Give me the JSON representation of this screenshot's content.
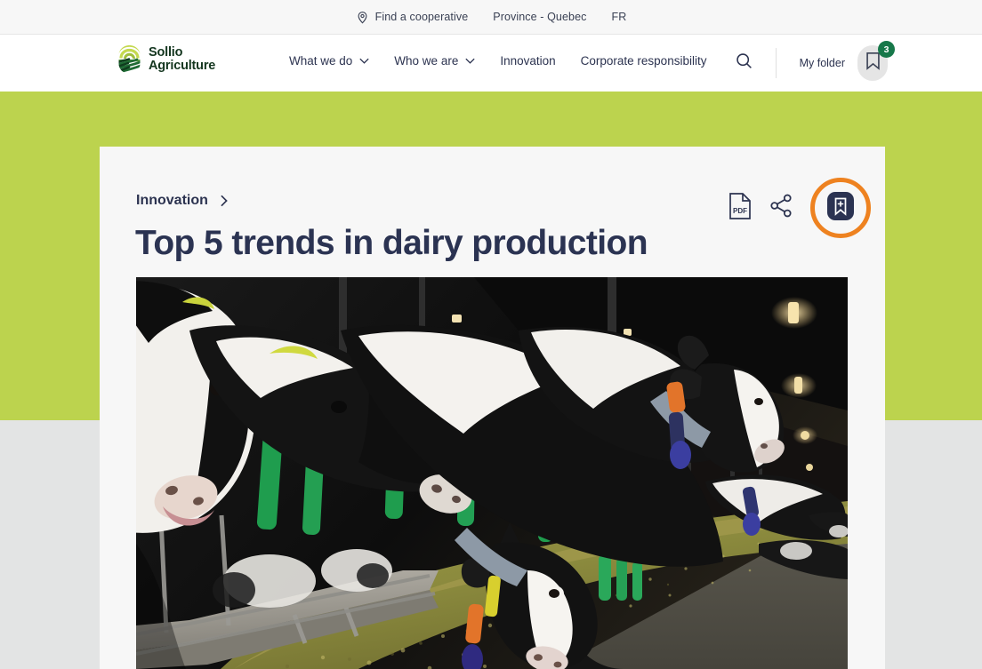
{
  "utility_bar": {
    "items": [
      {
        "label": "Find a cooperative",
        "icon": "location-pin-icon"
      },
      {
        "label": "Province - Quebec",
        "icon": null
      },
      {
        "label": "FR",
        "icon": null
      }
    ]
  },
  "header": {
    "logo": {
      "line1": "Sollio",
      "line2": "Agriculture",
      "icon": "sollio-field-logo"
    },
    "nav": [
      {
        "label": "What we do",
        "has_dropdown": true
      },
      {
        "label": "Who we are",
        "has_dropdown": true
      },
      {
        "label": "Innovation",
        "has_dropdown": false
      },
      {
        "label": "Corporate responsibility",
        "has_dropdown": false
      }
    ],
    "search_icon": "search-icon",
    "my_folder_label": "My folder",
    "folder_icon": "bookmark-icon",
    "folder_badge_count": "3"
  },
  "content": {
    "breadcrumb": {
      "label": "Innovation",
      "chevron": "chevron-right-icon"
    },
    "title": "Top 5 trends in dairy production",
    "actions": [
      {
        "name": "download-pdf",
        "icon": "pdf-file-icon",
        "label": "PDF"
      },
      {
        "name": "share",
        "icon": "share-icon",
        "label": ""
      },
      {
        "name": "save-to-folder",
        "icon": "bookmark-plus-icon",
        "label": "",
        "focused": true
      }
    ],
    "hero_image_alt": "Holstein dairy cows feeding at a barn feed alley with green headlock rails and monitoring collars"
  },
  "colors": {
    "brand_green_band": "#bcd34e",
    "logo_dark_green": "#14361f",
    "navy_text": "#2b3352",
    "accent_orange": "#ee8220",
    "badge_green": "#17784a",
    "card_bg": "#f7f7f7",
    "page_bg": "#e3e4e4"
  }
}
